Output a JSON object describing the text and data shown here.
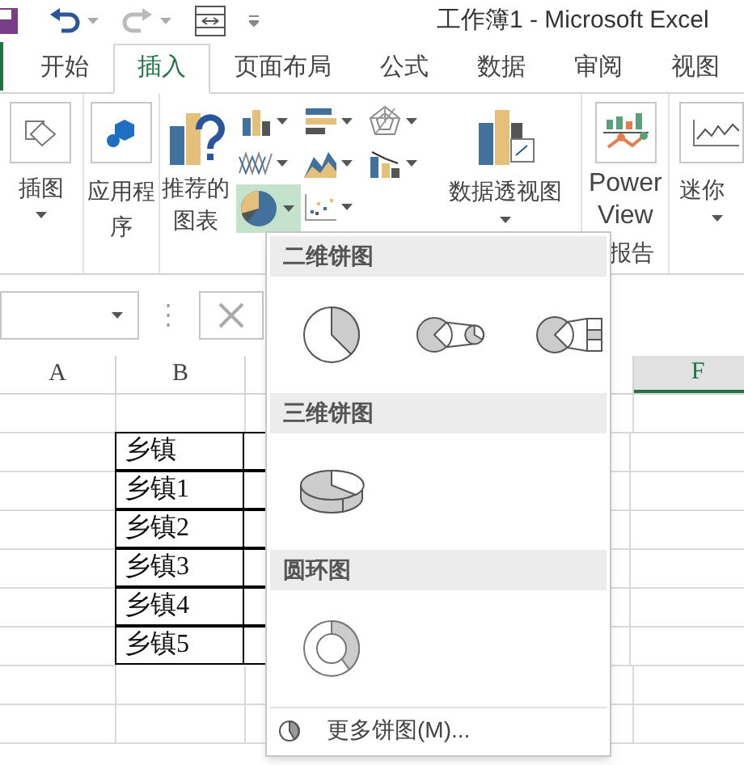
{
  "window": {
    "title": "工作簿1 - Microsoft Excel"
  },
  "tabs": [
    {
      "label": "开始",
      "selected": false
    },
    {
      "label": "插入",
      "selected": true
    },
    {
      "label": "页面布局",
      "selected": false
    },
    {
      "label": "公式",
      "selected": false
    },
    {
      "label": "数据",
      "selected": false
    },
    {
      "label": "审阅",
      "selected": false
    },
    {
      "label": "视图",
      "selected": false
    }
  ],
  "ribbon": {
    "illustrations": {
      "label": "插图"
    },
    "apps": {
      "label": "应用程序"
    },
    "recommended": {
      "label": "推荐的图表"
    },
    "chart_buttons": [
      {
        "kind": "column",
        "expanded": false
      },
      {
        "kind": "bar",
        "expanded": false
      },
      {
        "kind": "radar",
        "expanded": false
      },
      {
        "kind": "line",
        "expanded": false
      },
      {
        "kind": "area",
        "expanded": false
      },
      {
        "kind": "combo",
        "expanded": false
      },
      {
        "kind": "pie",
        "expanded": true
      },
      {
        "kind": "scatter",
        "expanded": false
      }
    ],
    "pivot_chart": {
      "label": "数据透视图"
    },
    "power_view": {
      "label": "Power View"
    },
    "group_label": "报告",
    "sparklines": {
      "label": "迷你"
    }
  },
  "columns": [
    {
      "label": "A",
      "selected": false
    },
    {
      "label": "B",
      "selected": false
    },
    {
      "label": "F",
      "selected": true
    }
  ],
  "table_rows": [
    "乡镇",
    "乡镇1",
    "乡镇2",
    "乡镇3",
    "乡镇4",
    "乡镇5"
  ],
  "dropdown": {
    "sections": [
      {
        "title": "二维饼图",
        "items": [
          {
            "kind": "pie"
          },
          {
            "kind": "pie-of-pie"
          },
          {
            "kind": "bar-of-pie"
          }
        ]
      },
      {
        "title": "三维饼图",
        "items": [
          {
            "kind": "pie-3d"
          }
        ]
      },
      {
        "title": "圆环图",
        "items": [
          {
            "kind": "doughnut"
          }
        ]
      }
    ],
    "more": "更多饼图(M)..."
  }
}
